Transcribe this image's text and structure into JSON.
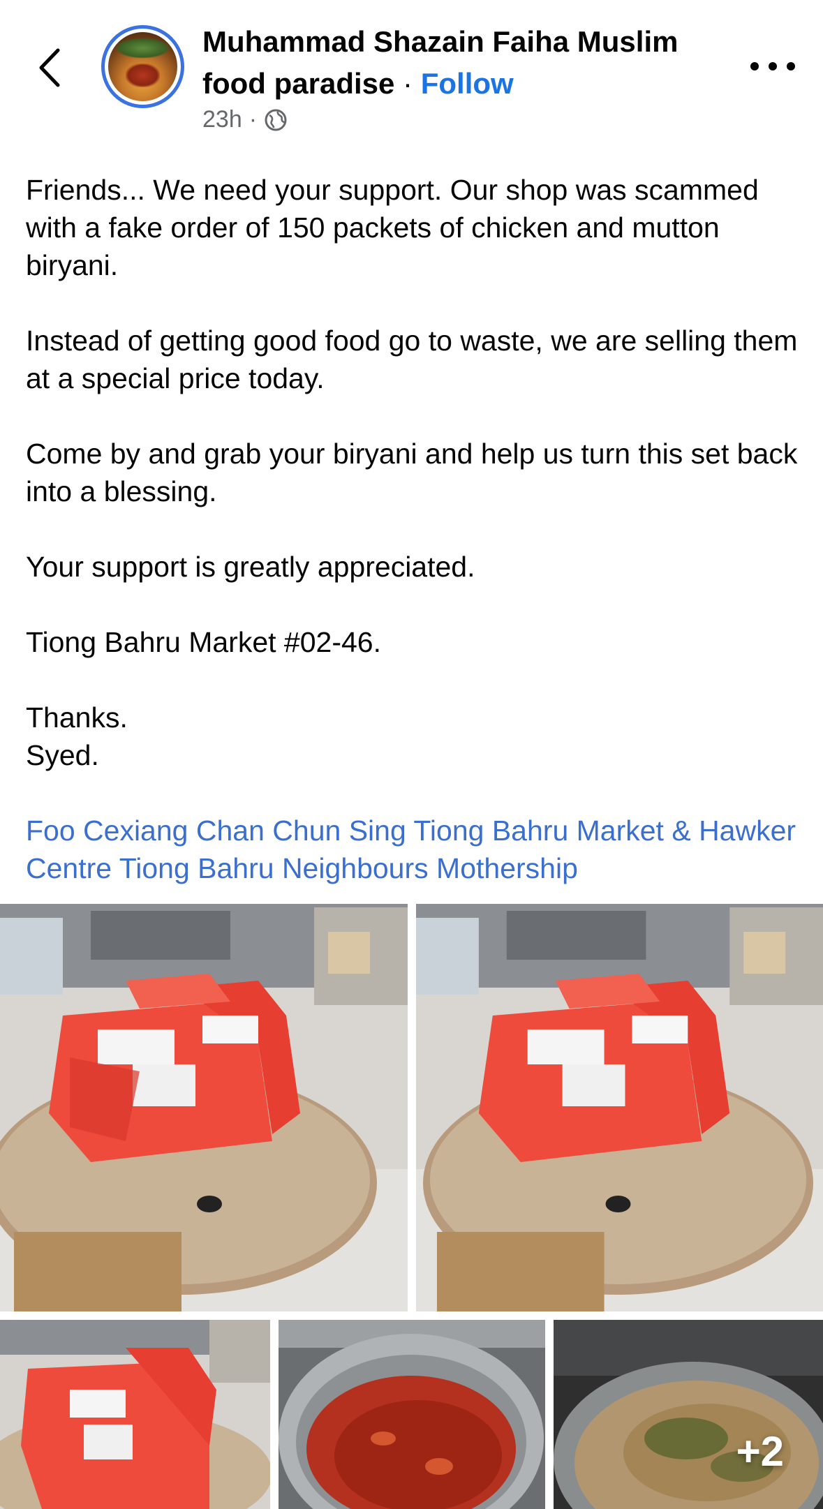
{
  "header": {
    "author_line1": "Muhammad Shazain Faiha Muslim",
    "author_line2": "food paradise",
    "separator": " · ",
    "follow_label": "Follow",
    "timestamp": "23h",
    "meta_separator": "·",
    "privacy_icon": "globe-icon",
    "back_icon": "chevron-left-icon",
    "more_icon": "more-horizontal-icon"
  },
  "post": {
    "paragraphs": [
      "Friends... We need your support. Our shop was scammed with a fake order of 150 packets of chicken and mutton biryani.",
      "Instead of getting good food go to waste, we are selling them at a special price today.",
      "Come by and grab your biryani and help us turn this set back into a blessing.",
      "Your support is greatly appreciated.",
      "Tiong Bahru Market #02-46.",
      "Thanks.\nSyed."
    ],
    "tags": [
      "Foo Cexiang",
      "Chan Chun Sing",
      "Tiong Bahru Market & Hawker Centre",
      "Tiong Bahru Neighbours",
      "Mothership"
    ]
  },
  "photos": {
    "count": 5,
    "extra_count_label": "+2"
  },
  "colors": {
    "link_blue": "#1b74e4",
    "tag_blue": "#3a6fd0",
    "meta_gray": "#65676b",
    "bag_red": "#ef4b3c"
  }
}
